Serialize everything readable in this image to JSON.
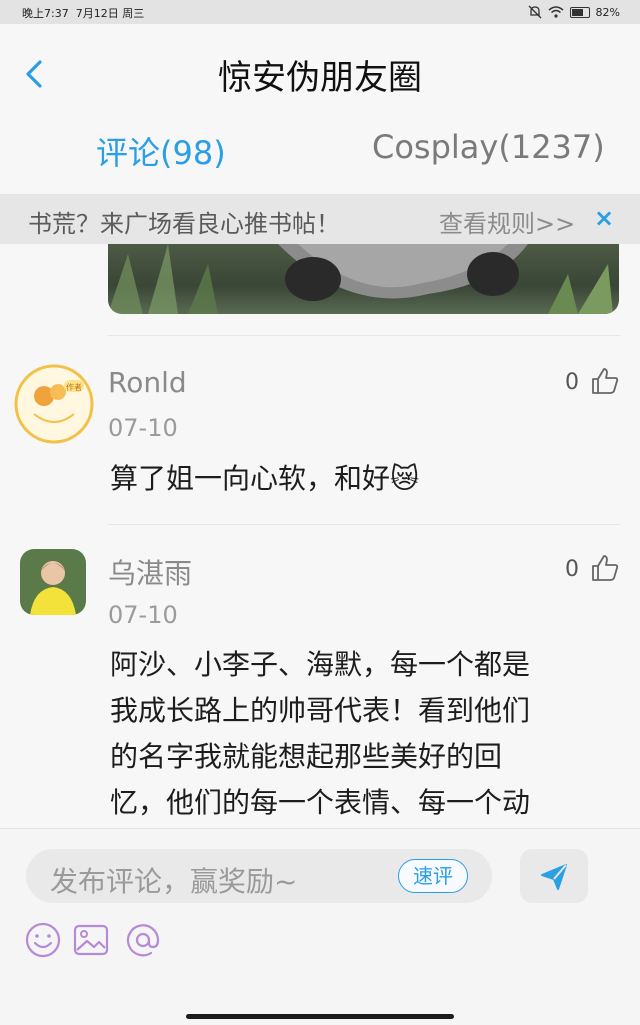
{
  "status": {
    "time": "晚上7:37",
    "date": "7月12日 周三",
    "battery": "82%",
    "battery_level": 0.82
  },
  "header": {
    "title": "惊安伪朋友圈",
    "back_icon": "chevron-left-icon"
  },
  "tabs": [
    {
      "label": "评论(98)",
      "active": true
    },
    {
      "label": "Cosplay(1237)",
      "active": false
    }
  ],
  "banner": {
    "text": "书荒？来广场看良心推书帖！",
    "link": "查看规则>>",
    "close": "×"
  },
  "comments": [
    {
      "user": "Ronld",
      "date": "07-10",
      "likes": "0",
      "text": "算了姐一向心软，和好😿",
      "avatar_badge": "作者"
    },
    {
      "user": "乌湛雨",
      "date": "07-10",
      "likes": "0",
      "lines": [
        "阿沙、小李子、海默，每一个都是",
        "我成长路上的帅哥代表！看到他们",
        "的名字我就能想起那些美好的回",
        "忆，他们的每一个表情、每一个动"
      ]
    }
  ],
  "composer": {
    "placeholder": "发布评论，赢奖励~",
    "quick_review": "速评",
    "tools": [
      "emoji-icon",
      "image-icon",
      "mention-icon"
    ]
  },
  "colors": {
    "accent": "#2a9ee6",
    "tool_icon": "#b58ad8"
  }
}
